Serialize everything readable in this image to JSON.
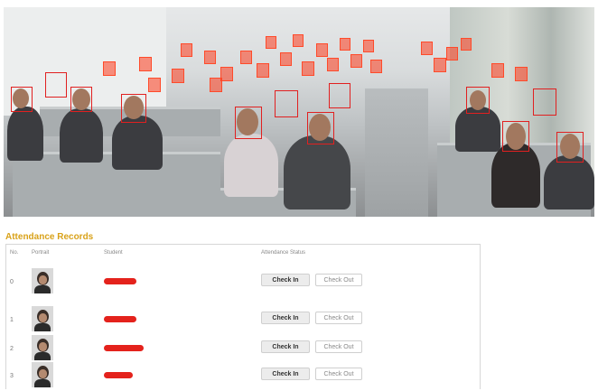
{
  "watermark_text": "",
  "panel": {
    "title": "Attendance Records",
    "columns": [
      "No.",
      "Portrait",
      "Student",
      "Attendance Status"
    ]
  },
  "records": [
    {
      "index": "0",
      "check_in": "Check In",
      "check_out": "Check Out"
    },
    {
      "index": "1",
      "check_in": "Check In",
      "check_out": "Check Out"
    },
    {
      "index": "2",
      "check_in": "Check In",
      "check_out": "Check Out"
    },
    {
      "index": "3",
      "check_in": "Check In",
      "check_out": "Check Out"
    }
  ],
  "colors": {
    "accent": "#d9a21a",
    "detection_box": "#e12020",
    "redaction": "#e4221c"
  }
}
